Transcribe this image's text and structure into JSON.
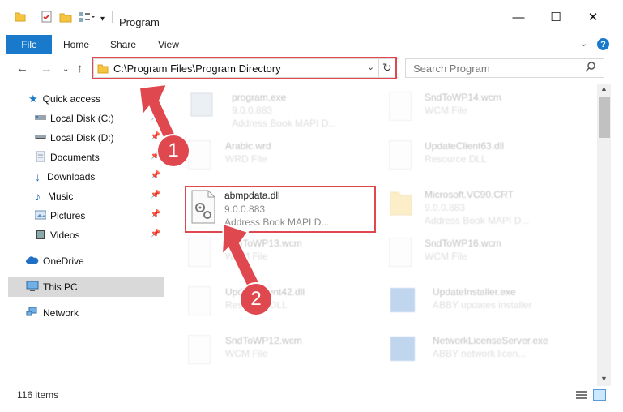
{
  "window": {
    "title": "Program",
    "controls": {
      "minimize": "—",
      "maximize": "☐",
      "close": "✕"
    }
  },
  "ribbon": {
    "tabs": [
      {
        "label": "File"
      },
      {
        "label": "Home"
      },
      {
        "label": "Share"
      },
      {
        "label": "View"
      }
    ],
    "help": "?"
  },
  "nav": {
    "address": "C:\\Program Files\\Program Directory",
    "search_placeholder": "Search Program"
  },
  "sidebar": {
    "items": [
      {
        "label": "Quick access",
        "icon": "star-icon",
        "pinned": false
      },
      {
        "label": "Local Disk (C:)",
        "icon": "drive-icon",
        "pinned": true
      },
      {
        "label": "Local Disk (D:)",
        "icon": "drive-icon",
        "pinned": true
      },
      {
        "label": "Documents",
        "icon": "documents-icon",
        "pinned": true
      },
      {
        "label": "Downloads",
        "icon": "download-icon",
        "pinned": true
      },
      {
        "label": "Music",
        "icon": "music-icon",
        "pinned": true
      },
      {
        "label": "Pictures",
        "icon": "pictures-icon",
        "pinned": true
      },
      {
        "label": "Videos",
        "icon": "videos-icon",
        "pinned": true
      },
      {
        "label": "OneDrive",
        "icon": "cloud-icon",
        "pinned": false
      },
      {
        "label": "This PC",
        "icon": "computer-icon",
        "pinned": false,
        "selected": true
      },
      {
        "label": "Network",
        "icon": "network-icon",
        "pinned": false
      }
    ]
  },
  "files": [
    {
      "name": "program.exe",
      "line2": "9.0.0.883",
      "line3": "Address Book MAPI D..."
    },
    {
      "name": "SndToWP14.wcm",
      "line2": "WCM File",
      "line3": ""
    },
    {
      "name": "Arabic.wrd",
      "line2": "WRD File",
      "line3": ""
    },
    {
      "name": "UpdateClient63.dll",
      "line2": "Resource DLL",
      "line3": ""
    },
    {
      "name": "abmpdata.dll",
      "line2": "9.0.0.883",
      "line3": "Address Book MAPI D..."
    },
    {
      "name": "Microsoft.VC90.CRT",
      "line2": "9.0.0.883",
      "line3": "Address Book MAPI D..."
    },
    {
      "name": "SndToWP13.wcm",
      "line2": "WCM File",
      "line3": ""
    },
    {
      "name": "SndToWP16.wcm",
      "line2": "WCM File",
      "line3": ""
    },
    {
      "name": "UpdateClient42.dll",
      "line2": "Resource DLL",
      "line3": ""
    },
    {
      "name": "UpdateInstaller.exe",
      "line2": "ABBY updates installer",
      "line3": ""
    },
    {
      "name": "SndToWP12.wcm",
      "line2": "WCM File",
      "line3": ""
    },
    {
      "name": "NetworkLicenseServer.exe",
      "line2": "ABBY network licen...",
      "line3": ""
    }
  ],
  "annotations": {
    "step1": "1",
    "step2": "2",
    "color": "#e0484f"
  },
  "status": {
    "count": "116 items"
  },
  "colors": {
    "accent": "#1979ca",
    "highlight": "#e0484f",
    "selected_bg": "#cce8ff"
  }
}
